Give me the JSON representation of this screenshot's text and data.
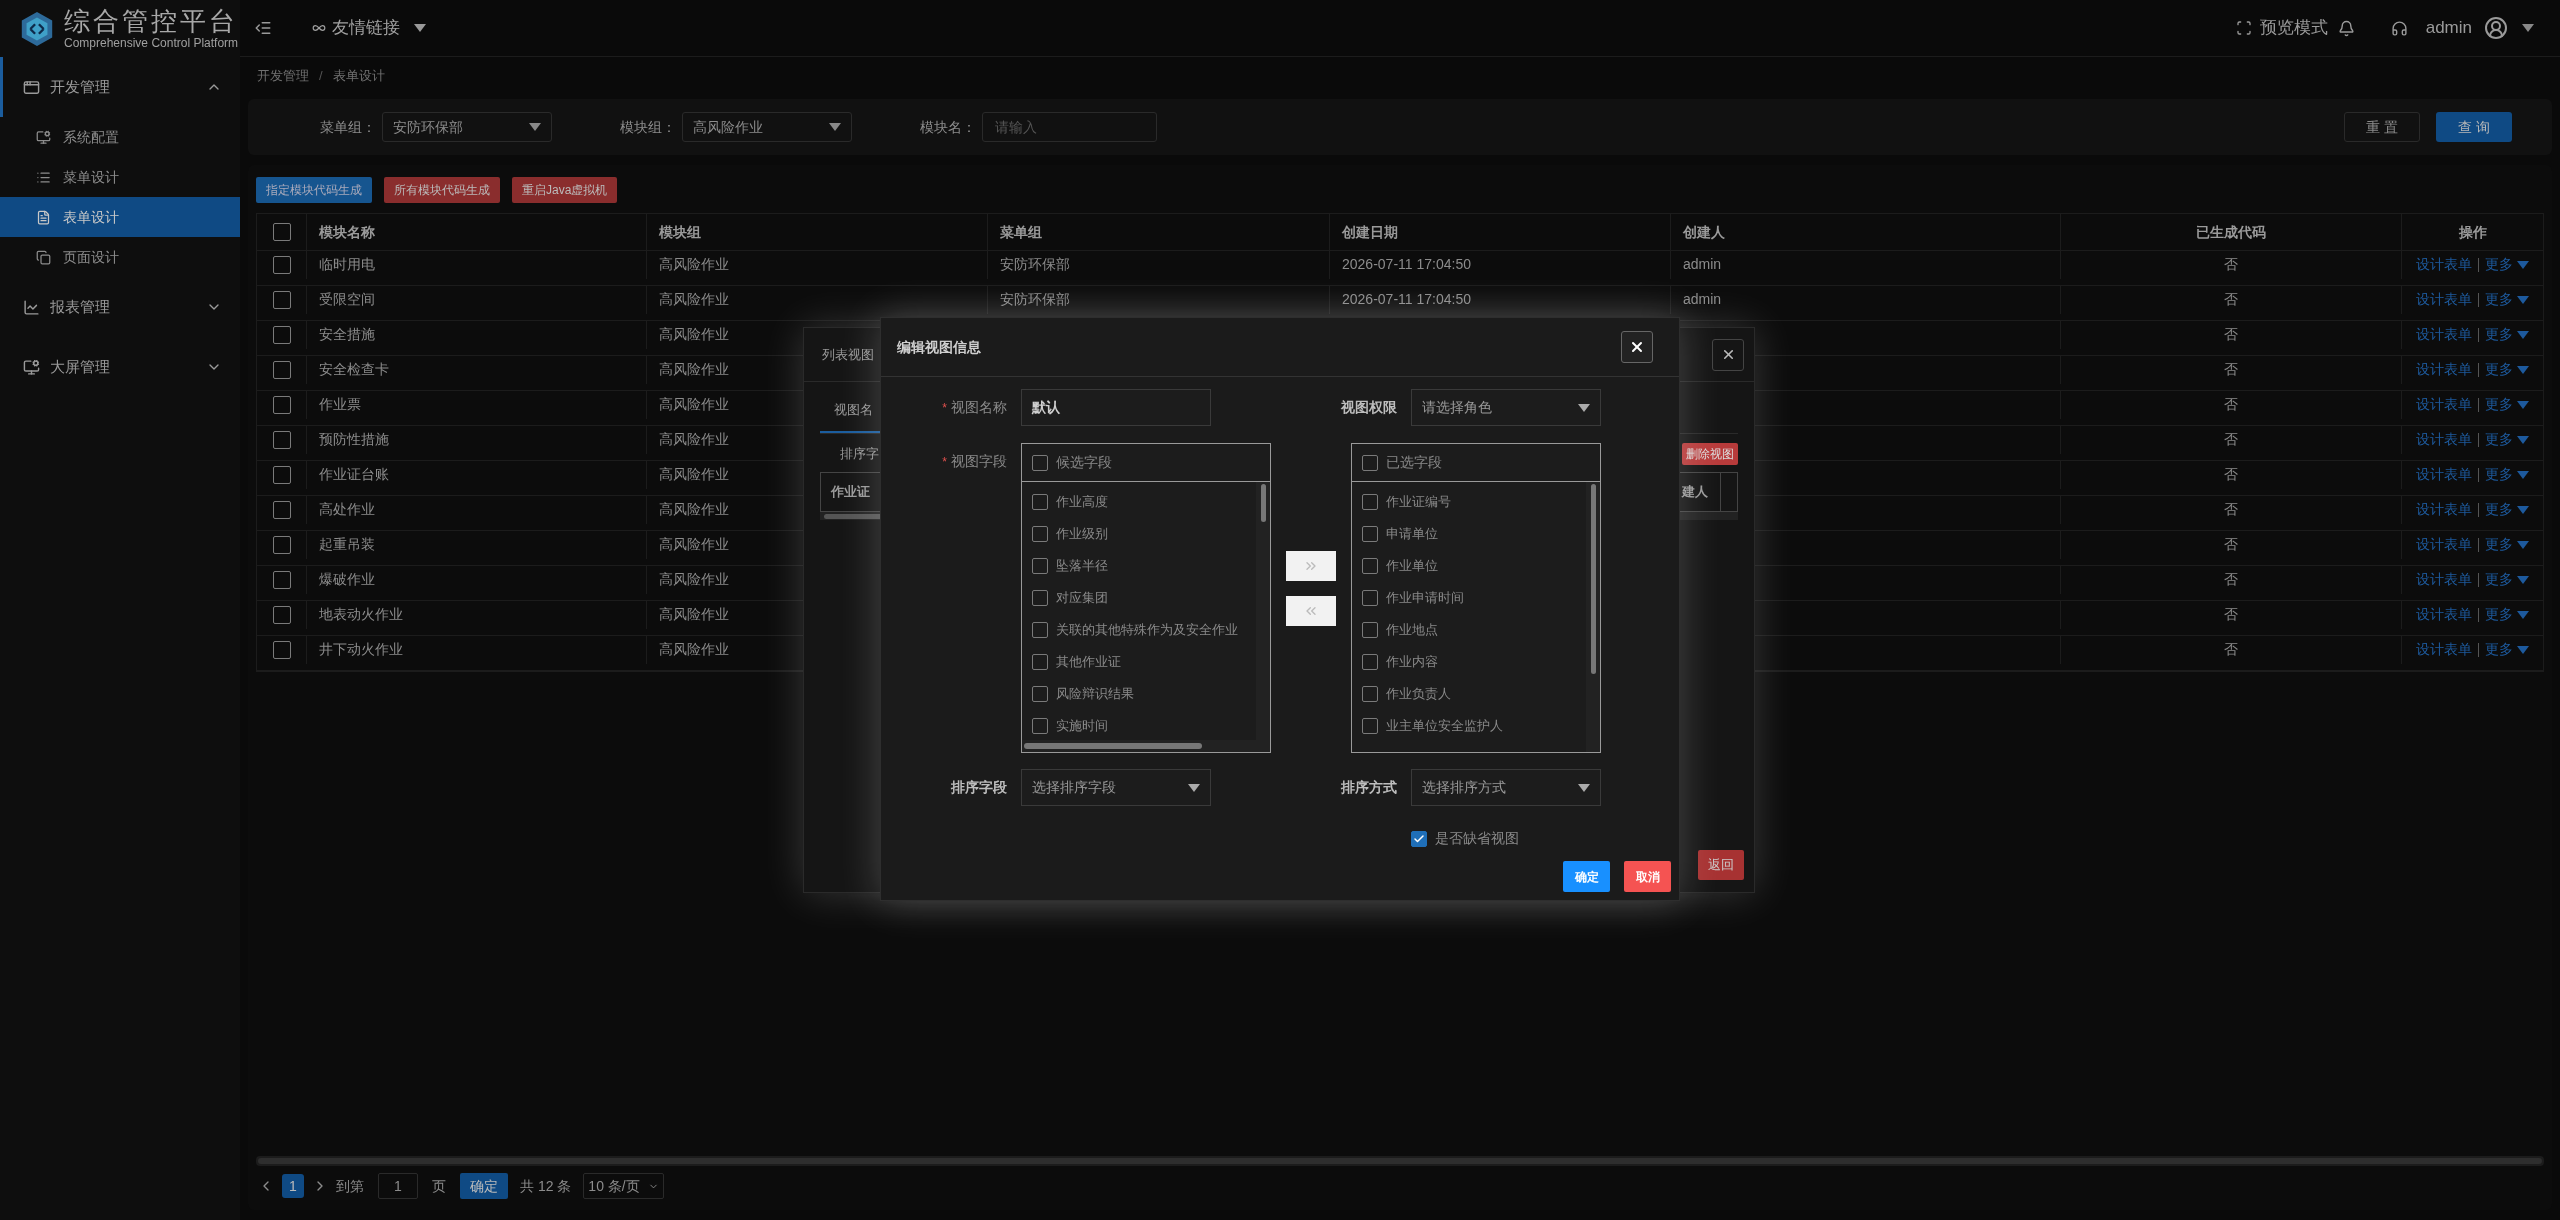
{
  "app": {
    "title": "综合管控平台",
    "subtitle": "Comprehensive Control Platform"
  },
  "header": {
    "link_menu": "友情链接",
    "preview": "预览模式",
    "user": "admin"
  },
  "sidebar": [
    {
      "label": "开发管理",
      "expanded": true,
      "children": [
        {
          "label": "系统配置",
          "selected": false
        },
        {
          "label": "菜单设计",
          "selected": false
        },
        {
          "label": "表单设计",
          "selected": true
        },
        {
          "label": "页面设计",
          "selected": false
        }
      ]
    },
    {
      "label": "报表管理",
      "expanded": false
    },
    {
      "label": "大屏管理",
      "expanded": false
    }
  ],
  "breadcrumb": {
    "separator": "/",
    "items": [
      "开发管理",
      "表单设计"
    ]
  },
  "filters": [
    {
      "kind": "select",
      "label": "菜单组：",
      "value": "安防环保部"
    },
    {
      "kind": "select",
      "label": "模块组：",
      "value": "高风险作业"
    },
    {
      "kind": "input",
      "label": "模块名：",
      "placeholder": "请输入"
    }
  ],
  "filter_buttons": [
    {
      "kind": "default",
      "label": "重 置"
    },
    {
      "kind": "primary",
      "label": "查 询"
    }
  ],
  "toolbar": [
    {
      "kind": "primary",
      "label": "指定模块代码生成"
    },
    {
      "kind": "danger",
      "label": "所有模块代码生成"
    },
    {
      "kind": "danger",
      "label": "重启Java虚拟机"
    }
  ],
  "table": {
    "all_checked": false,
    "columns": [
      "模块名称",
      "模块组",
      "菜单组",
      "创建日期",
      "创建人",
      "已生成代码",
      "操作"
    ],
    "rows": [
      {
        "checked": false,
        "name": "临时用电",
        "group": "高风险作业",
        "menu": "安防环保部",
        "date": "2026-07-11 17:04:50",
        "creator": "admin",
        "generated": "否",
        "action": "设计表单",
        "more": "更多"
      },
      {
        "checked": false,
        "name": "受限空间",
        "group": "高风险作业",
        "menu": "安防环保部",
        "date": "2026-07-11 17:04:50",
        "creator": "admin",
        "generated": "否",
        "action": "设计表单",
        "more": "更多"
      },
      {
        "checked": false,
        "name": "安全措施",
        "group": "高风险作业",
        "generated": "否",
        "action": "设计表单",
        "more": "更多"
      },
      {
        "checked": false,
        "name": "安全检查卡",
        "group": "高风险作业",
        "generated": "否",
        "action": "设计表单",
        "more": "更多"
      },
      {
        "checked": false,
        "name": "作业票",
        "group": "高风险作业",
        "generated": "否",
        "action": "设计表单",
        "more": "更多"
      },
      {
        "checked": false,
        "name": "预防性措施",
        "group": "高风险作业",
        "generated": "否",
        "action": "设计表单",
        "more": "更多"
      },
      {
        "checked": false,
        "name": "作业证台账",
        "group": "高风险作业",
        "generated": "否",
        "action": "设计表单",
        "more": "更多"
      },
      {
        "checked": false,
        "name": "高处作业",
        "group": "高风险作业",
        "generated": "否",
        "action": "设计表单",
        "more": "更多"
      },
      {
        "checked": false,
        "name": "起重吊装",
        "group": "高风险作业",
        "generated": "否",
        "action": "设计表单",
        "more": "更多"
      },
      {
        "checked": false,
        "name": "爆破作业",
        "group": "高风险作业",
        "generated": "否",
        "action": "设计表单",
        "more": "更多"
      },
      {
        "checked": false,
        "name": "地表动火作业",
        "group": "高风险作业",
        "generated": "否",
        "action": "设计表单",
        "more": "更多"
      },
      {
        "checked": false,
        "name": "井下动火作业",
        "group": "高风险作业",
        "generated": "否",
        "action": "设计表单",
        "more": "更多"
      }
    ]
  },
  "pagination": {
    "page": "1",
    "goto_label": "到第",
    "goto_value": "1",
    "page_unit": "页",
    "confirm": "确定",
    "total": "共 12 条",
    "page_size": "10 条/页"
  },
  "back_dialog": {
    "title": "列表视图",
    "tab": "视图名",
    "sort_label": "排序字",
    "delete_button": "删除视图",
    "column_first": "作业证",
    "column_last": "建人",
    "return_button": "返回"
  },
  "dialog": {
    "title": "编辑视图信息",
    "name_label": {
      "mark": "*",
      "text": "视图名称"
    },
    "name_value": "默认",
    "perm_label": "视图权限",
    "perm_placeholder": "请选择角色",
    "fields_label": {
      "mark": "*",
      "text": "视图字段"
    },
    "candidate": {
      "header": "候选字段",
      "checked": false,
      "items": [
        {
          "label": "作业高度",
          "checked": false
        },
        {
          "label": "作业级别",
          "checked": false
        },
        {
          "label": "坠落半径",
          "checked": false
        },
        {
          "label": "对应集团",
          "checked": false
        },
        {
          "label": "关联的其他特殊作为及安全作业",
          "checked": false
        },
        {
          "label": "其他作业证",
          "checked": false
        },
        {
          "label": "风险辩识结果",
          "checked": false
        },
        {
          "label": "实施时间",
          "checked": false
        }
      ]
    },
    "chosen": {
      "header": "已选字段",
      "checked": false,
      "items": [
        {
          "label": "作业证编号",
          "checked": false
        },
        {
          "label": "申请单位",
          "checked": false
        },
        {
          "label": "作业单位",
          "checked": false
        },
        {
          "label": "作业申请时间",
          "checked": false
        },
        {
          "label": "作业地点",
          "checked": false
        },
        {
          "label": "作业内容",
          "checked": false
        },
        {
          "label": "作业负责人",
          "checked": false
        },
        {
          "label": "业主单位安全监护人",
          "checked": false
        }
      ]
    },
    "sort_field_label": "排序字段",
    "sort_field_placeholder": "选择排序字段",
    "sort_order_label": "排序方式",
    "sort_order_placeholder": "选择排序方式",
    "default_view": {
      "label": "是否缺省视图",
      "checked": true
    },
    "ok": "确定",
    "cancel": "取消"
  }
}
